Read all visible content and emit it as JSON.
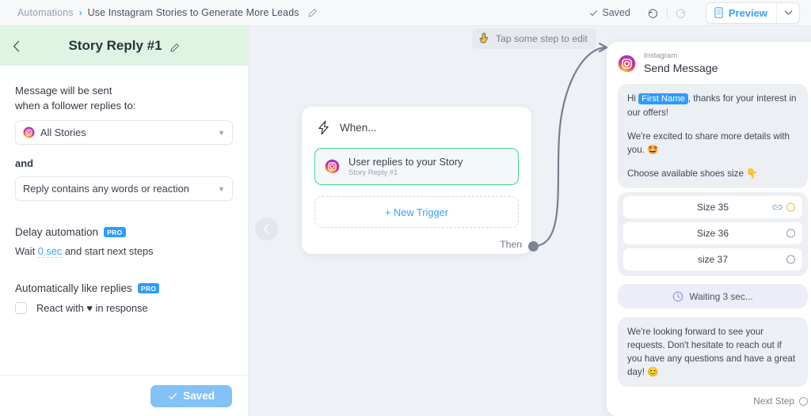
{
  "topbar": {
    "breadcrumb_root": "Automations",
    "breadcrumb_sep": "›",
    "breadcrumb_current": "Use Instagram Stories to Generate More Leads",
    "edit_icon": "pencil-icon",
    "saved_status": "Saved",
    "undo_icon": "undo-icon",
    "redo_icon": "redo-icon",
    "preview_label": "Preview",
    "preview_icon": "mobile-phone-icon",
    "preview_caret_icon": "chevron-down-icon",
    "accent_blue": "#38a0fb"
  },
  "sidebar": {
    "back_icon": "chevron-left-icon",
    "title": "Story Reply #1",
    "title_edit_icon": "pencil-icon",
    "header_bg": "#dff4e3",
    "intro_label": "Message will be sent\nwhen a follower replies to:",
    "intro_line1": "Message will be sent",
    "intro_line2": "when a follower replies to:",
    "story_select": {
      "icon": "instagram-icon",
      "value": "All Stories",
      "caret_icon": "caret-down-icon"
    },
    "conjunction": "and",
    "condition_select": {
      "value": "Reply contains any words or reaction",
      "caret_icon": "caret-down-icon"
    },
    "delay_section": {
      "title": "Delay automation",
      "badge": "PRO",
      "wait_prefix": "Wait ",
      "wait_value": "0 sec",
      "wait_suffix": " and start next steps"
    },
    "like_section": {
      "title": "Automatically like replies",
      "badge": "PRO",
      "checkbox_checked": false,
      "label_prefix": "React with ",
      "label_emoji": "♥",
      "label_suffix": " in response"
    },
    "footer_save_label": "Saved",
    "footer_save_icon": "check-icon",
    "footer_save_color": "#83c2f7"
  },
  "canvas": {
    "tooltip": {
      "icon": "pointing-hand-icon",
      "text": "Tap some step to edit"
    },
    "collapse_icon": "chevron-left-icon",
    "trigger_card": {
      "header_icon": "lightning-bolt-icon",
      "header_label": "When...",
      "trigger_icon": "instagram-icon",
      "trigger_title": "User replies to your Story",
      "trigger_subtitle": "Story Reply #1",
      "trigger_border_color": "#3ddc8a",
      "new_trigger_label": "+ New Trigger",
      "then_label": "Then"
    },
    "connector": {
      "from_label": "Then",
      "arrow_icon": "arrow-right-icon",
      "color": "#78808f"
    }
  },
  "message_panel": {
    "platform": "Instagram",
    "icon": "instagram-icon",
    "title": "Send Message",
    "bubble1": {
      "line1_prefix": "Hi ",
      "variable": "First Name",
      "line1_suffix": ", thanks for your interest in our offers!",
      "paragraph2": "We're excited to share more details with you. 🤩",
      "paragraph3": "Choose available shoes size 👇"
    },
    "choices": [
      {
        "label": "Size 35",
        "has_link_icon": true,
        "circle_color": "#f5b63f"
      },
      {
        "label": "Size 36",
        "has_link_icon": false,
        "circle_color": "#8d9bb0"
      },
      {
        "label": "size 37",
        "has_link_icon": false,
        "circle_color": "#8d9bb0"
      }
    ],
    "waiting": {
      "icon": "clock-icon",
      "label": "Waiting 3 sec..."
    },
    "bubble2": "We're looking forward to see your requests. Don't hesitate to reach out if you have any questions and have a great day! 😊",
    "next_step_label": "Next Step",
    "next_step_icon": "circle-outline-icon"
  }
}
